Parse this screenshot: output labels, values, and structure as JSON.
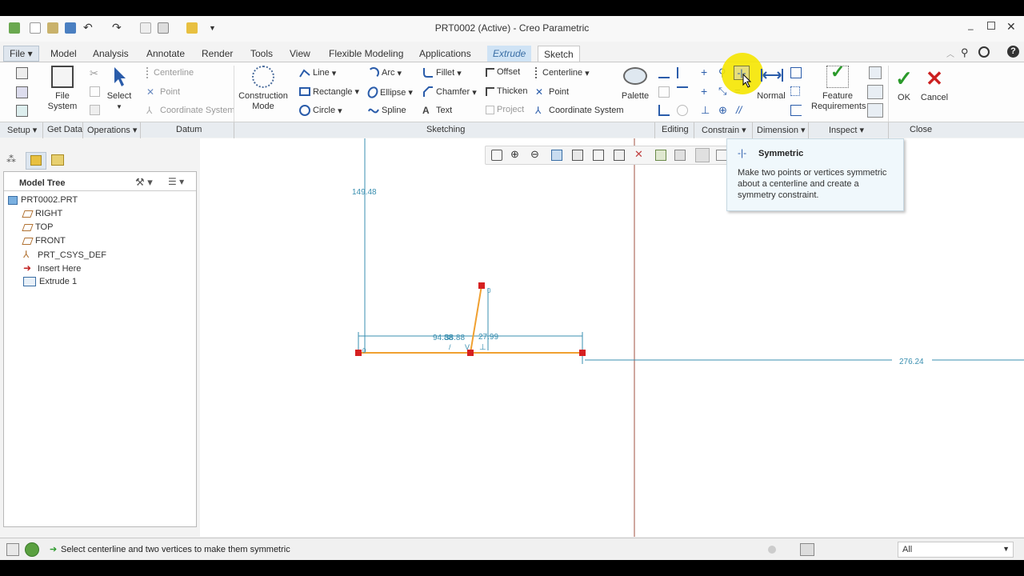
{
  "window": {
    "title": "PRT0002 (Active) - Creo Parametric"
  },
  "tabs": [
    {
      "label": "File"
    },
    {
      "label": "Model"
    },
    {
      "label": "Analysis"
    },
    {
      "label": "Annotate"
    },
    {
      "label": "Render"
    },
    {
      "label": "Tools"
    },
    {
      "label": "View"
    },
    {
      "label": "Flexible Modeling"
    },
    {
      "label": "Applications"
    },
    {
      "label": "Extrude"
    },
    {
      "label": "Sketch"
    }
  ],
  "ribbon": {
    "file_system": "File\nSystem",
    "select": "Select",
    "datum": {
      "centerline": "Centerline",
      "point": "Point",
      "coordinate_system": "Coordinate System"
    },
    "construction_mode": "Construction\nMode",
    "sketching": {
      "line": "Line",
      "rectangle": "Rectangle",
      "circle": "Circle",
      "arc": "Arc",
      "ellipse": "Ellipse",
      "spline": "Spline",
      "fillet": "Fillet",
      "chamfer": "Chamfer",
      "text": "Text",
      "offset": "Offset",
      "thicken": "Thicken",
      "project": "Project",
      "centerline": "Centerline",
      "point": "Point",
      "coordinate_system": "Coordinate System",
      "palette": "Palette"
    },
    "dimension": {
      "normal": "Normal"
    },
    "inspect": {
      "feature_requirements": "Feature\nRequirements"
    },
    "close": {
      "ok": "OK",
      "cancel": "Cancel"
    }
  },
  "groups": {
    "setup": "Setup",
    "get_data": "Get Data",
    "operations": "Operations",
    "datum": "Datum",
    "sketching": "Sketching",
    "editing": "Editing",
    "constrain": "Constrain",
    "dimension": "Dimension",
    "inspect": "Inspect",
    "close": "Close"
  },
  "model_tree": {
    "header": "Model Tree",
    "items": [
      {
        "label": "PRT0002.PRT"
      },
      {
        "label": "RIGHT"
      },
      {
        "label": "TOP"
      },
      {
        "label": "FRONT"
      },
      {
        "label": "PRT_CSYS_DEF"
      },
      {
        "label": "Insert Here"
      },
      {
        "label": "Extrude 1"
      }
    ]
  },
  "sketch": {
    "dimensions": [
      "149.48",
      "94.88",
      "38.88",
      "27.99",
      "276.24"
    ]
  },
  "tooltip": {
    "title": "Symmetric",
    "body": "Make two points or vertices symmetric about a centerline and create a symmetry constraint."
  },
  "status": {
    "message": "Select centerline and two vertices to make them symmetric",
    "filter": "All"
  },
  "colors": {
    "accent": "#3a6ea5",
    "highlight": "#f5e600",
    "sketch_line": "#f0a030",
    "dimension": "#3a8fb0",
    "vertex": "#d62020",
    "ok_green": "#2a9a2a",
    "cancel_red": "#cc2020"
  }
}
